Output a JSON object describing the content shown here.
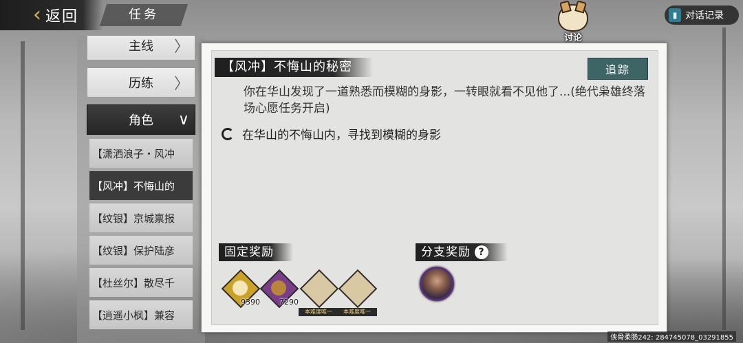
{
  "header": {
    "back_label": "返回",
    "title": "任务",
    "discuss_label": "讨论",
    "dialog_log_label": "对话记录"
  },
  "sidebar": {
    "categories": [
      {
        "label": "主线"
      },
      {
        "label": "历练"
      },
      {
        "label": "角色"
      }
    ],
    "quests": [
      {
        "label": "【潇洒浪子・风冲"
      },
      {
        "label": "【风冲】不悔山的"
      },
      {
        "label": "【纹银】京城禀报"
      },
      {
        "label": "【纹银】保护陆彦"
      },
      {
        "label": "【杜丝尔】散尽千"
      },
      {
        "label": "【逍遥小枫】兼容"
      }
    ]
  },
  "quest": {
    "title": "【风冲】不悔山的秘密",
    "track_label": "追踪",
    "description": "你在华山发现了一道熟悉而模糊的身影，一转眼就看不见他了...(绝代枭雄终落场心愿任务开启)",
    "objective": "在华山的不悔山内，寻找到模糊的身影"
  },
  "rewards": {
    "fixed_label": "固定奖励",
    "branch_label": "分支奖励",
    "items": [
      {
        "count": "9390",
        "icon": "gold-coin-icon",
        "color": "#c9a227",
        "tag": ""
      },
      {
        "count": "7290",
        "icon": "copper-coin-icon",
        "color": "#7a3d8a",
        "tag": ""
      },
      {
        "count": "",
        "icon": "inner-skill-scroll-icon",
        "color": "#d9c9a3",
        "tag": "本难度唯一"
      },
      {
        "count": "",
        "icon": "martial-skill-scroll-icon",
        "color": "#d9c9a3",
        "tag": "本难度唯一"
      }
    ]
  },
  "watermark": "侠骨柔肠242: 284745078_03291855"
}
